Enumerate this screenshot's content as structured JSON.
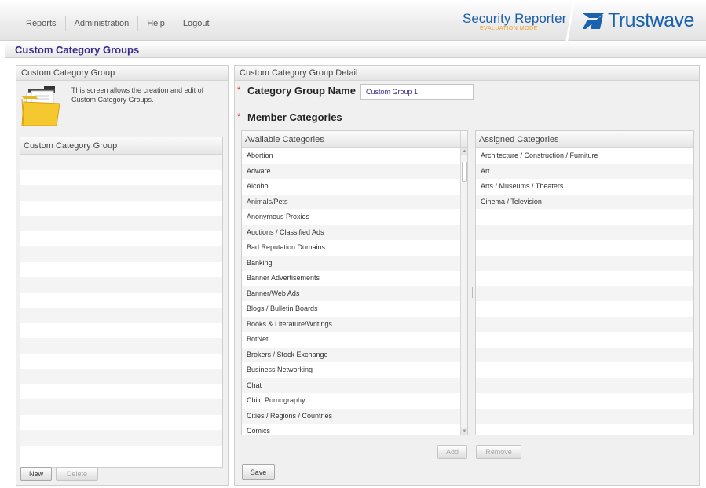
{
  "nav": {
    "items": [
      "Reports",
      "Administration",
      "Help",
      "Logout"
    ]
  },
  "product": {
    "name": "Security Reporter",
    "mode": "EVALUATION MODE",
    "brand": "Trustwave",
    "brand_color": "#1a62ad"
  },
  "page": {
    "title": "Custom Category Groups"
  },
  "left_panel": {
    "header": "Custom Category Group",
    "intro_text": "This screen allows the creation and edit of Custom Category Groups.",
    "intro_icon": "folder-icon",
    "list_header": "Custom Category Group",
    "items": [],
    "new_label": "New",
    "delete_label": "Delete"
  },
  "detail": {
    "header": "Custom Category Group Detail",
    "required_marker": "*",
    "group_name_label": "Category Group Name",
    "group_name_value": "Custom Group 1",
    "member_label": "Member Categories",
    "available_header": "Available Categories",
    "assigned_header": "Assigned Categories",
    "available": [
      "Abortion",
      "Adware",
      "Alcohol",
      "Animals/Pets",
      "Anonymous Proxies",
      "Auctions / Classified Ads",
      "Bad Reputation Domains",
      "Banking",
      "Banner Advertisements",
      "Banner/Web Ads",
      "Blogs / Bulletin Boards",
      "Books & Literature/Writings",
      "BotNet",
      "Brokers / Stock Exchange",
      "Business Networking",
      "Chat",
      "Child Pornography",
      "Cities / Regions / Countries",
      "Comics"
    ],
    "assigned": [
      "Architecture / Construction / Furniture",
      "Art",
      "Arts / Museums / Theaters",
      "Cinema / Television"
    ],
    "add_label": "Add",
    "remove_label": "Remove",
    "save_label": "Save"
  },
  "colors": {
    "title_text": "#3a2a8c",
    "product_blue": "#1f5fa8",
    "eval_orange": "#f0a030",
    "required_red": "#d23"
  }
}
